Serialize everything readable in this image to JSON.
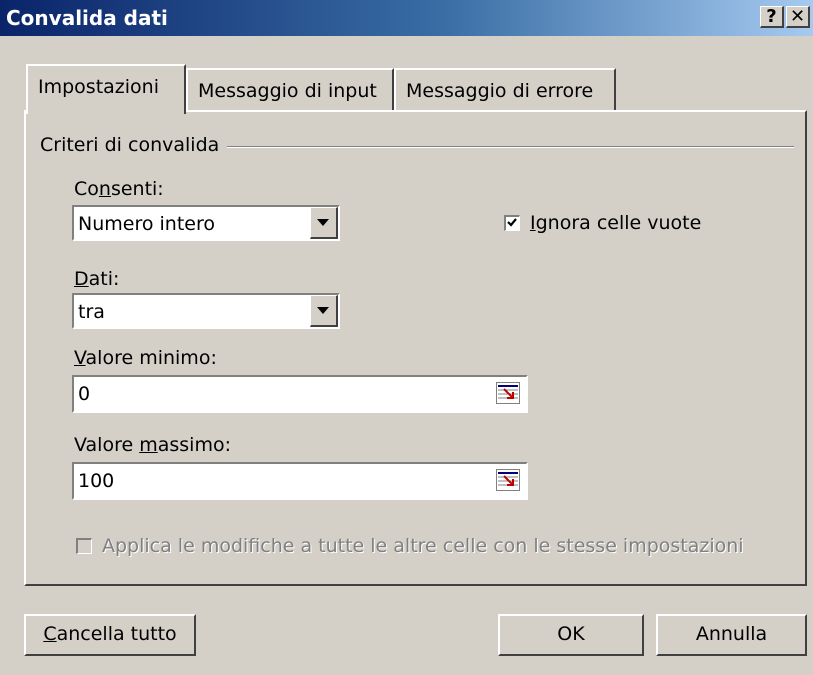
{
  "window": {
    "title": "Convalida dati",
    "help_button": "?",
    "close_button": "✕"
  },
  "tabs": [
    {
      "label": "Impostazioni",
      "active": true
    },
    {
      "label": "Messaggio di input",
      "active": false
    },
    {
      "label": "Messaggio di errore",
      "active": false
    }
  ],
  "criteria": {
    "group_label": "Criteri di convalida",
    "allow_label_pre": "Co",
    "allow_label_u": "n",
    "allow_label_post": "senti:",
    "allow_value": "Numero intero",
    "ignore_blank_u": "I",
    "ignore_blank_post": "gnora celle vuote",
    "ignore_blank_checked": true,
    "data_label_u": "D",
    "data_label_post": "ati:",
    "data_value": "tra",
    "min_label_u": "V",
    "min_label_post": "alore minimo:",
    "min_value": "0",
    "max_label_pre": "Valore ",
    "max_label_u": "m",
    "max_label_post": "assimo:",
    "max_value": "100",
    "apply_all_label": "Applica le modifiche a tutte le altre celle con le stesse impostazioni",
    "apply_all_checked": false,
    "apply_all_enabled": false
  },
  "buttons": {
    "clear_all_u": "C",
    "clear_all_post": "ancella tutto",
    "ok": "OK",
    "cancel": "Annulla"
  }
}
